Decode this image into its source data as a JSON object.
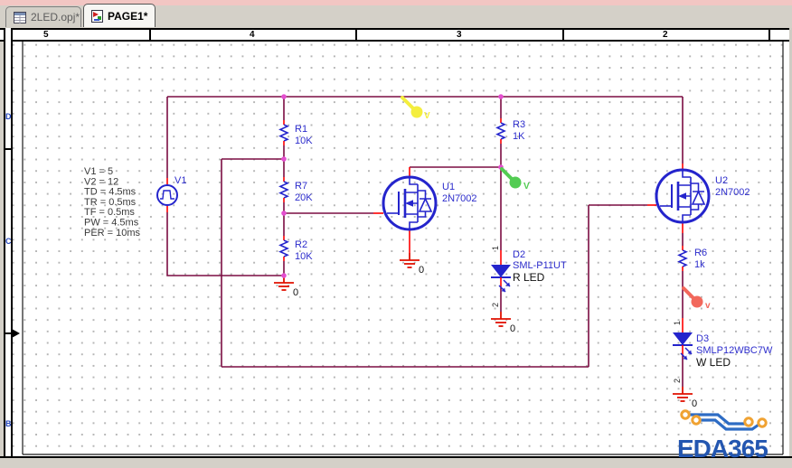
{
  "window": {
    "tabs": [
      {
        "label": "2LED.opj*"
      },
      {
        "label": "PAGE1*"
      }
    ]
  },
  "rulers": {
    "h": [
      "5",
      "4",
      "3",
      "2"
    ],
    "v": [
      "D",
      "C",
      "B"
    ]
  },
  "colors": {
    "wire": "#7b0d42",
    "part": "#2424cc",
    "pin": "#ff0000",
    "junction": "#e44fd0",
    "ground": "#e01000",
    "marker_yellow": "#f4ee3e",
    "marker_green": "#53cc53",
    "marker_red": "#f2685c",
    "logo_blue": "#2356b0",
    "pad_orange": "#f0a232",
    "label_blue": "#2d2dcc",
    "tab_pink": "#f2c6c3"
  },
  "schematic": {
    "source": {
      "ref": "V1",
      "params": [
        "V1 = 5",
        "V2 = 12",
        "TD = 4.5ms",
        "TR = 0.5ms",
        "TF = 0.5ms",
        "PW = 4.5ms",
        "PER = 10ms"
      ]
    },
    "resistors": [
      {
        "ref": "R1",
        "value": "10K"
      },
      {
        "ref": "R7",
        "value": "20K"
      },
      {
        "ref": "R2",
        "value": "10K"
      },
      {
        "ref": "R3",
        "value": "1K"
      },
      {
        "ref": "R6",
        "value": "1k"
      }
    ],
    "mosfets": [
      {
        "ref": "U1",
        "value": "2N7002"
      },
      {
        "ref": "U2",
        "value": "2N7002"
      }
    ],
    "leds": [
      {
        "ref": "D2",
        "value": "SML-P11UT",
        "note": "R LED",
        "pin1": "1",
        "pin2": "2"
      },
      {
        "ref": "D3",
        "value": "SMLP12WBC7W",
        "note": "W LED",
        "pin1": "1",
        "pin2": "2"
      }
    ],
    "ground_label": "0",
    "markers": [
      {
        "label": "V"
      },
      {
        "label": "V"
      },
      {
        "label": "v"
      }
    ],
    "logo": "EDA365"
  }
}
